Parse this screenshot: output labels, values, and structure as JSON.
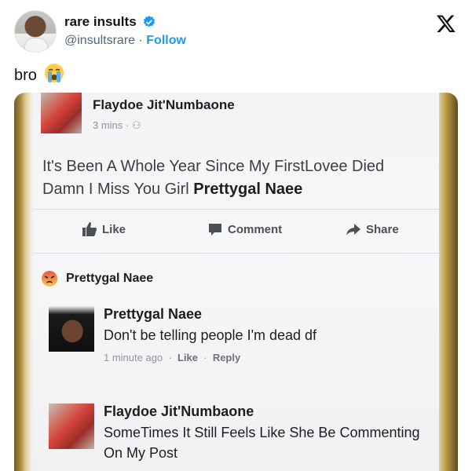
{
  "tweet": {
    "display_name": "rare insults",
    "handle": "@insultsrare",
    "separator": "·",
    "follow_label": "Follow",
    "text": "bro",
    "emoji": "crying-face-emoji",
    "colors": {
      "accent": "#1d9bf0",
      "text": "#0f1419",
      "muted": "#536471"
    }
  },
  "post": {
    "author": "Flaydoe Jit'Numbaone",
    "meta": "3 mins · ⚇",
    "body_text": "It's Been A Whole Year Since My FirstLovee Died Damn I Miss You Girl",
    "body_tag": "Prettygal Naee",
    "actions": {
      "like": "Like",
      "comment": "Comment",
      "share": "Share"
    }
  },
  "reaction": {
    "name": "Prettygal Naee",
    "icon": "angry-face-icon"
  },
  "comments": [
    {
      "name": "Prettygal Naee",
      "text": "Don't be telling people I'm dead df",
      "time": "1 minute ago",
      "sep": "·",
      "like": "Like",
      "reply": "Reply"
    },
    {
      "name": "Flaydoe Jit'Numbaone",
      "text": "SomeTimes It Still Feels Like She Be Commenting On My Post"
    }
  ]
}
